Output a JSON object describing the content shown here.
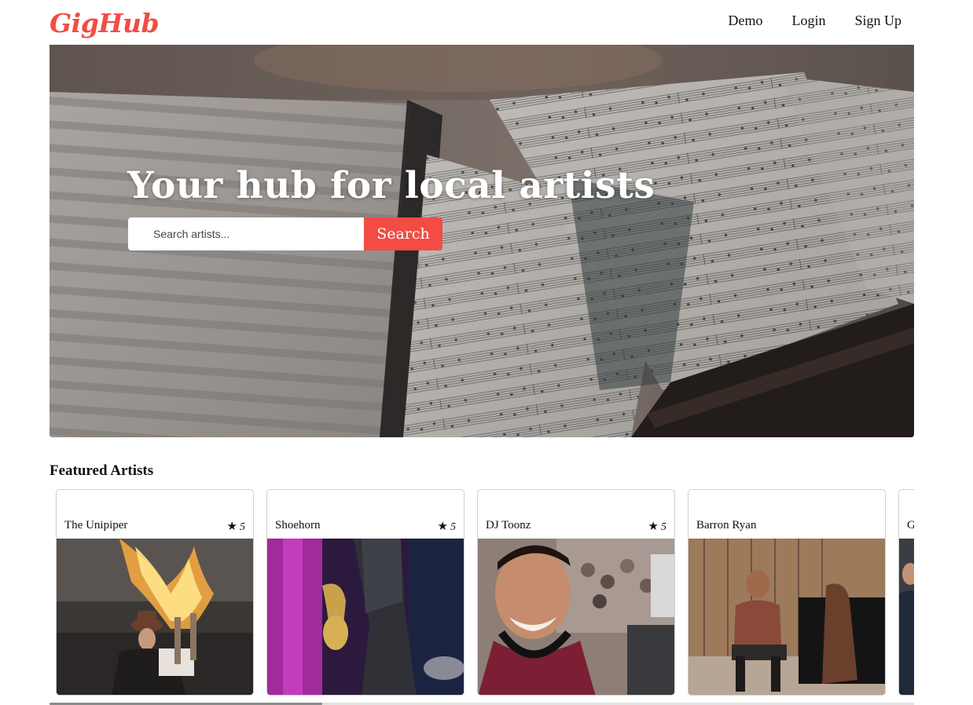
{
  "brand": {
    "name": "GigHub",
    "accent": "#f24c44"
  },
  "nav": {
    "items": [
      "Demo",
      "Login",
      "Sign Up"
    ]
  },
  "hero": {
    "title": "Your hub for local artists",
    "search": {
      "placeholder": "Search artists...",
      "value": "",
      "button_label": "Search"
    }
  },
  "featured": {
    "title": "Featured Artists",
    "artists": [
      {
        "name": "The Unipiper",
        "rating": "5",
        "image": "bagpiper-with-flames"
      },
      {
        "name": "Shoehorn",
        "rating": "5",
        "image": "saxophonist-on-stage"
      },
      {
        "name": "DJ Toonz",
        "rating": "5",
        "image": "dj-selfie-crowd"
      },
      {
        "name": "Barron Ryan",
        "rating": "",
        "image": "pianist-seated"
      },
      {
        "name": "G",
        "rating": "",
        "image": "partial-portrait"
      }
    ]
  },
  "icons": {
    "rating": "star-icon"
  }
}
